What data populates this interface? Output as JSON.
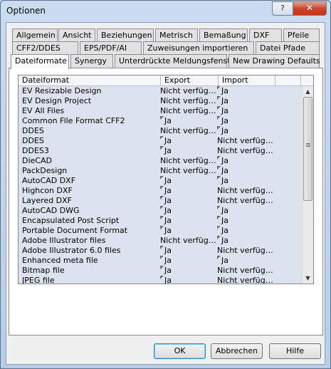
{
  "window": {
    "title": "Optionen",
    "help_label": "?",
    "close_label": "✕"
  },
  "tabs_row1": [
    "Allgemein",
    "Ansicht",
    "Beziehungen",
    "Metrisch",
    "Bemaßung",
    "DXF",
    "Pfeile"
  ],
  "tabs_row2": [
    "CFF2/DDES",
    "EPS/PDF/AI",
    "Zuweisungen importieren",
    "Datei Pfade"
  ],
  "tabs_row3": [
    "Dateiformate",
    "Synergy",
    "Unterdrückte Meldungsfenster",
    "New Drawing Defaults"
  ],
  "active_tab": "Dateiformate",
  "table": {
    "headers": [
      "Dateiformat",
      "Export",
      "Import"
    ],
    "rows": [
      {
        "format": "EV Resizable Design",
        "export": "Nicht verfüg…",
        "import": "Ja",
        "export_flag": false,
        "import_flag": true
      },
      {
        "format": "EV Design Project",
        "export": "Nicht verfüg…",
        "import": "Ja",
        "export_flag": false,
        "import_flag": true
      },
      {
        "format": "EV All Files",
        "export": "Nicht verfüg…",
        "import": "Ja",
        "export_flag": false,
        "import_flag": true
      },
      {
        "format": "Common File Format CFF2",
        "export": "Ja",
        "import": "Ja",
        "export_flag": true,
        "import_flag": true
      },
      {
        "format": "DDES",
        "export": "Nicht verfüg…",
        "import": "Ja",
        "export_flag": false,
        "import_flag": true
      },
      {
        "format": "DDES",
        "export": "Ja",
        "import": "Nicht verfüg…",
        "export_flag": true,
        "import_flag": false
      },
      {
        "format": "DDES3",
        "export": "Ja",
        "import": "Nicht verfüg…",
        "export_flag": true,
        "import_flag": false
      },
      {
        "format": "DieCAD",
        "export": "Nicht verfüg…",
        "import": "Ja",
        "export_flag": false,
        "import_flag": true
      },
      {
        "format": "PackDesign",
        "export": "Nicht verfüg…",
        "import": "Ja",
        "export_flag": false,
        "import_flag": true
      },
      {
        "format": "AutoCAD DXF",
        "export": "Ja",
        "import": "Ja",
        "export_flag": true,
        "import_flag": true
      },
      {
        "format": "Highcon DXF",
        "export": "Ja",
        "import": "Nicht verfüg…",
        "export_flag": true,
        "import_flag": false
      },
      {
        "format": "Layered DXF",
        "export": "Ja",
        "import": "Nicht verfüg…",
        "export_flag": true,
        "import_flag": false
      },
      {
        "format": "AutoCAD DWG",
        "export": "Ja",
        "import": "Ja",
        "export_flag": true,
        "import_flag": true
      },
      {
        "format": "Encapsulated Post Script",
        "export": "Ja",
        "import": "Ja",
        "export_flag": true,
        "import_flag": true
      },
      {
        "format": "Portable Document Format",
        "export": "Ja",
        "import": "Ja",
        "export_flag": true,
        "import_flag": true
      },
      {
        "format": "Adobe Illustrator files",
        "export": "Nicht verfüg…",
        "import": "Ja",
        "export_flag": false,
        "import_flag": true
      },
      {
        "format": "Adobe Illustrator 6.0 files",
        "export": "Ja",
        "import": "Nicht verfüg…",
        "export_flag": true,
        "import_flag": false
      },
      {
        "format": "Enhanced meta file",
        "export": "Ja",
        "import": "Ja",
        "export_flag": true,
        "import_flag": true
      },
      {
        "format": "Bitmap file",
        "export": "Ja",
        "import": "Nicht verfüg…",
        "export_flag": true,
        "import_flag": false
      },
      {
        "format": "JPEG file",
        "export": "Ja",
        "import": "Nicht verfüg…",
        "export_flag": true,
        "import_flag": false
      }
    ]
  },
  "buttons": {
    "ok": "OK",
    "cancel": "Abbrechen",
    "help": "Hilfe"
  },
  "icons": {
    "up_arrow": "scroll-up-arrow-icon",
    "down_arrow": "scroll-down-arrow-icon"
  }
}
